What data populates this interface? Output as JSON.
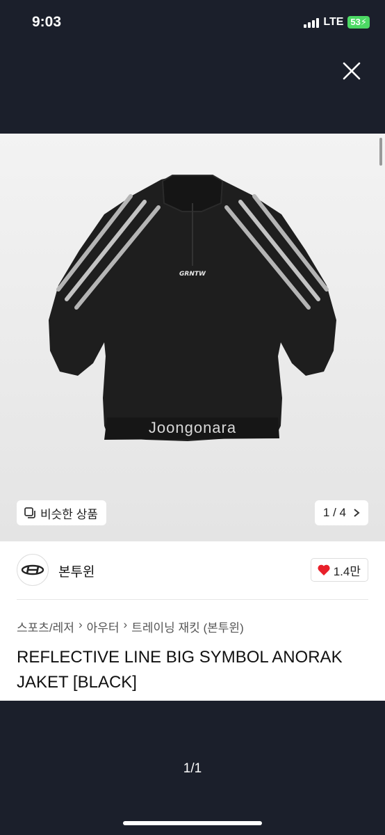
{
  "status": {
    "time": "9:03",
    "network": "LTE",
    "battery": "53"
  },
  "product": {
    "watermark": "Joongonara",
    "similar_label": "비슷한 상품",
    "image_counter": "1 / 4",
    "seller_name": "본투윈",
    "likes": "1.4만",
    "breadcrumb": [
      "스포츠/레저",
      "아우터",
      "트레이닝 재킷 (본투윈)"
    ],
    "title": "REFLECTIVE LINE BIG SYMBOL ANORAK JAKET [BLACK]",
    "graphic_text": "GRNTW"
  },
  "pager": "1/1",
  "colors": {
    "like_heart": "#e8202a",
    "battery": "#4cd964",
    "background": "#1b1f2b"
  }
}
